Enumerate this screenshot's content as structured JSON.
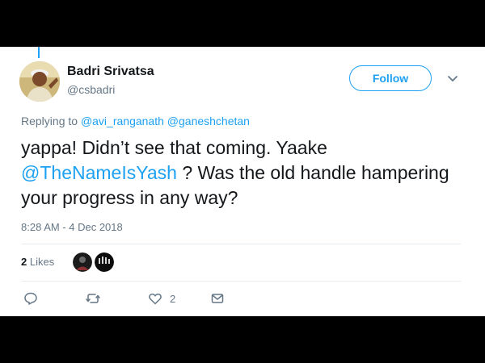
{
  "tweet": {
    "author_name": "Badri Srivatsa",
    "author_handle": "@csbadri",
    "follow_label": "Follow",
    "reply_prefix": "Replying to",
    "reply_to": [
      "@avi_ranganath",
      "@ganeshchetan"
    ],
    "text_part1": "yappa! Didn’t see that coming. Yaake",
    "mention": "@TheNameIsYash",
    "text_part2": " ? Was the old handle hampering your progress in any way?",
    "timestamp": "8:28 AM - 4 Dec 2018",
    "likes_count": "2",
    "likes_label": "Likes",
    "heart_count": "2"
  },
  "icons": {
    "menu": "chevron-down-icon",
    "reply": "reply-icon",
    "retweet": "retweet-icon",
    "like": "heart-icon",
    "dm": "envelope-icon"
  },
  "colors": {
    "accent": "#1da1f2",
    "muted": "#657786",
    "text": "#14171a",
    "letterbox": "#000000"
  }
}
